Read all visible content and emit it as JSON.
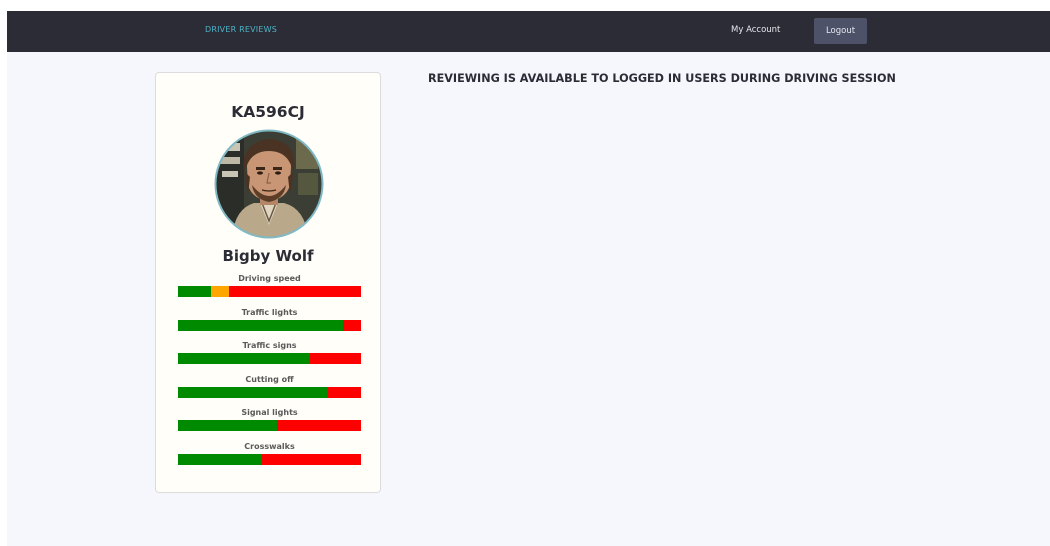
{
  "navbar": {
    "brand": "DRIVER REVIEWS",
    "my_account": "My Account",
    "logout": "Logout"
  },
  "notice": "REVIEWING IS AVAILABLE TO LOGGED IN USERS DURING DRIVING SESSION",
  "card": {
    "plate": "KA596CJ",
    "driver_name": "Bigby Wolf",
    "metrics": [
      {
        "label": "Driving speed",
        "good": 0.18,
        "neutral": 0.1,
        "bad": 0.72
      },
      {
        "label": "Traffic lights",
        "good": 0.9,
        "neutral": 0.0,
        "bad": 0.1
      },
      {
        "label": "Traffic signs",
        "good": 0.72,
        "neutral": 0.0,
        "bad": 0.28
      },
      {
        "label": "Cutting off",
        "good": 0.82,
        "neutral": 0.0,
        "bad": 0.18
      },
      {
        "label": "Signal lights",
        "good": 0.54,
        "neutral": 0.0,
        "bad": 0.46
      },
      {
        "label": "Crosswalks",
        "good": 0.46,
        "neutral": 0.0,
        "bad": 0.54
      }
    ]
  },
  "colors": {
    "good": "#008a00",
    "neutral": "#ffa500",
    "bad": "#ff0000",
    "navbar": "#2b2c36",
    "brand": "#4fb3c8"
  }
}
